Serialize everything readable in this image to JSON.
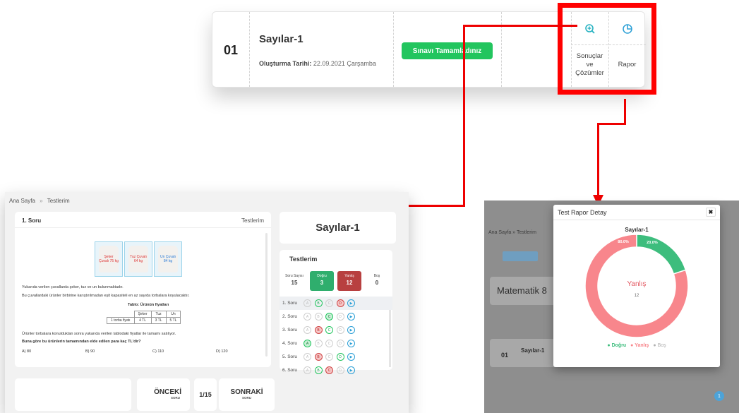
{
  "top_card": {
    "number": "01",
    "title": "Sayılar-1",
    "date_label": "Oluşturma Tarihi:",
    "date_value": "22.09.2021 Çarşamba",
    "status_button": "Sınavı Tamamladınız",
    "results_label_1": "Sonuçlar",
    "results_label_2": "ve",
    "results_label_3": "Çözümler",
    "report_label": "Rapor"
  },
  "left": {
    "breadcrumb_home": "Ana Sayfa",
    "breadcrumb_sep": "»",
    "breadcrumb_current": "Testlerim",
    "question_header": "1. Soru",
    "question_tab": "Testlerim",
    "sacks": [
      "Şeker Çuvalı 75 kg",
      "Tuz Çuvalı 64 kg",
      "Un Çuvalı 84 kg"
    ],
    "q_line1": "Yukarıda verilen çuvallarda şeker, tuz ve un bulunmaktadır.",
    "q_line2": "Bu çuvallardaki ürünler birbirine karıştırılmadan eşit kapasiteli en az sayıda torbalara koyulacaktır.",
    "table_caption": "Tablo: Ürünün fiyatları",
    "table_head": [
      "",
      "Şeker",
      "Tuz",
      "Un"
    ],
    "table_row": [
      "1 torba fiyatı",
      "4 TL",
      "3 TL",
      "5 TL"
    ],
    "q_line3": "Ürünler torbalara konulduktan sonra yukarıda verilen tablodaki fiyatlar ile tamamı satılıyor.",
    "q_line4": "Buna göre bu ürünlerin tamamından elde edilen para kaç TL'dir?",
    "answers": [
      "A) 80",
      "B) 90",
      "C) 110",
      "D) 120"
    ],
    "test_title": "Sayılar-1",
    "tests_header": "Testlerim",
    "stats": {
      "total_label": "Soru Sayısı",
      "total_value": "15",
      "correct_label": "Doğru",
      "correct_value": "3",
      "wrong_label": "Yanlış",
      "wrong_value": "12",
      "empty_label": "Boş",
      "empty_value": "0"
    },
    "rows": [
      {
        "label": "1. Soru",
        "opts": [
          "A",
          "B",
          "C",
          "D"
        ],
        "marks": [
          "n",
          "g",
          "n",
          "r"
        ]
      },
      {
        "label": "2. Soru",
        "opts": [
          "A",
          "B",
          "C",
          "D"
        ],
        "marks": [
          "n",
          "n",
          "gf",
          "n"
        ]
      },
      {
        "label": "3. Soru",
        "opts": [
          "A",
          "B",
          "C",
          "D"
        ],
        "marks": [
          "n",
          "r",
          "g",
          "n"
        ]
      },
      {
        "label": "4. Soru",
        "opts": [
          "A",
          "B",
          "C",
          "D"
        ],
        "marks": [
          "gf",
          "n",
          "n",
          "n"
        ]
      },
      {
        "label": "5. Soru",
        "opts": [
          "A",
          "B",
          "C",
          "D"
        ],
        "marks": [
          "n",
          "r",
          "n",
          "g"
        ]
      },
      {
        "label": "6. Soru",
        "opts": [
          "A",
          "B",
          "C",
          "D"
        ],
        "marks": [
          "n",
          "g",
          "r",
          "n"
        ]
      }
    ],
    "prev_label": "ÖNCEKİ",
    "prev_sub": "SORU",
    "page_indicator": "1/15",
    "next_label": "SONRAKİ",
    "next_sub": "SORU"
  },
  "right": {
    "breadcrumb": "Ana Sayfa » Testlerim",
    "subject": "Matematik 8",
    "card_title": "Sayılar-1",
    "card_number": "01",
    "page": "1",
    "modal_title": "Test Rapor Detay",
    "chart_title": "Sayılar-1",
    "center_label": "Yanlış",
    "center_value": "12",
    "legend_correct": "Doğru",
    "legend_wrong": "Yanlış",
    "legend_empty": "Boş"
  },
  "chart_data": {
    "type": "pie",
    "title": "Sayılar-1",
    "categories": [
      "Doğru",
      "Yanlış",
      "Boş"
    ],
    "values": [
      20.0,
      80.0,
      0.0
    ],
    "data_labels": [
      "20.0%",
      "80.0%",
      ""
    ],
    "colors": [
      "#3dbd7d",
      "#f8868c",
      "#b0b0b0"
    ],
    "legend_position": "bottom"
  },
  "colors": {
    "accent_green": "#22c55e",
    "highlight_red": "#ff0000",
    "wrong_red": "#b84040",
    "info_blue": "#2a9fd6"
  }
}
